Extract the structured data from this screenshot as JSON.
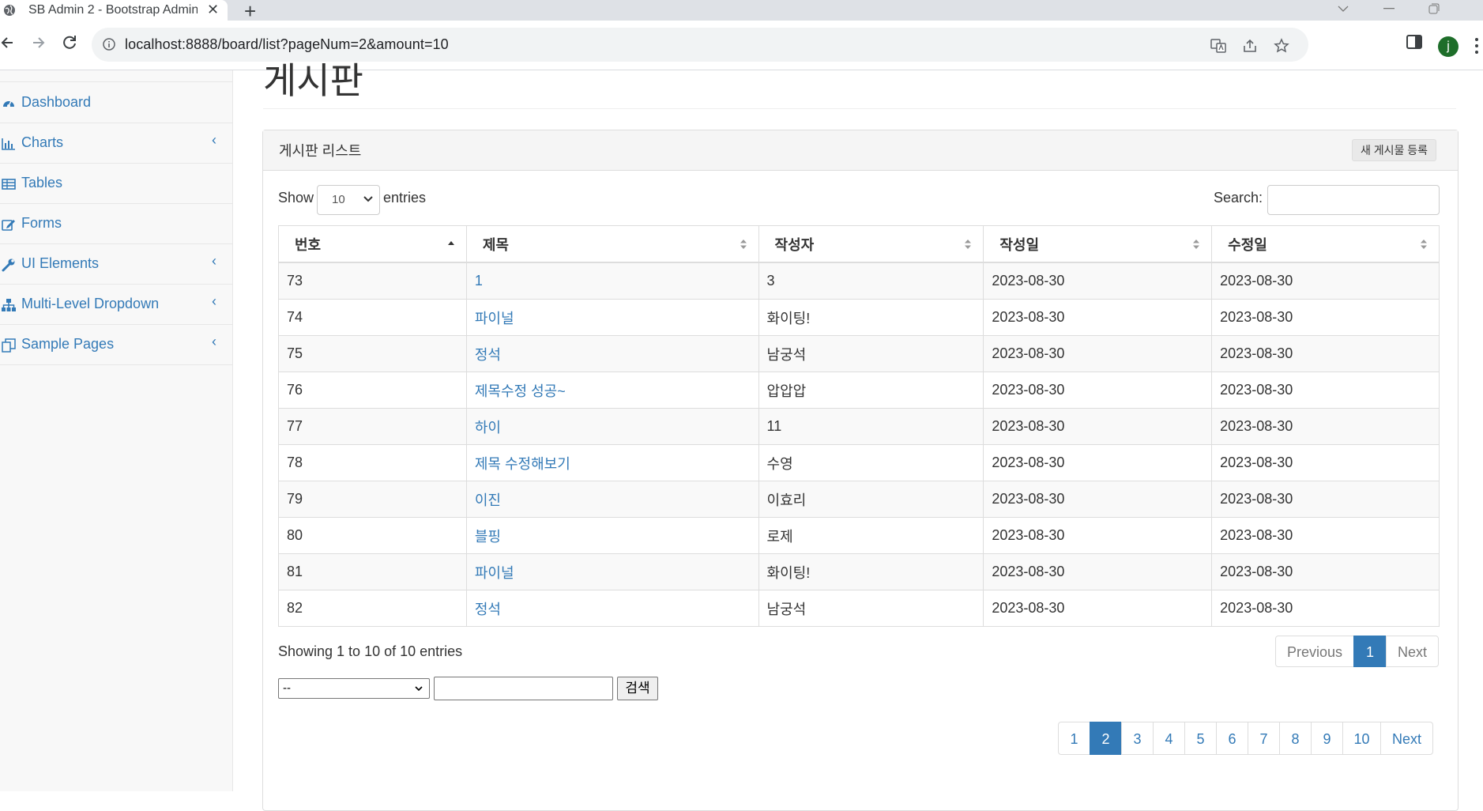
{
  "browser": {
    "tab_title": "SB Admin 2 - Bootstrap Admin",
    "tab_close": "✕",
    "new_tab": "+",
    "url": "localhost:8888/board/list?pageNum=2&amount=10",
    "profile_initial": "j"
  },
  "sidebar": {
    "items": [
      {
        "label": "Dashboard",
        "icon": "dashboard-icon",
        "caret": ""
      },
      {
        "label": "Charts",
        "icon": "bar-chart-icon",
        "caret": "‹"
      },
      {
        "label": "Tables",
        "icon": "table-icon",
        "caret": ""
      },
      {
        "label": "Forms",
        "icon": "edit-icon",
        "caret": ""
      },
      {
        "label": "UI Elements",
        "icon": "wrench-icon",
        "caret": "‹"
      },
      {
        "label": "Multi-Level Dropdown",
        "icon": "sitemap-icon",
        "caret": "‹"
      },
      {
        "label": "Sample Pages",
        "icon": "files-icon",
        "caret": "‹"
      }
    ]
  },
  "page": {
    "title": "게시판"
  },
  "panel": {
    "heading": "게시판 리스트",
    "register_button": "새 게시물 등록",
    "show_label": "Show",
    "page_length": "10",
    "entries_label": "entries",
    "search_label": "Search:",
    "columns": [
      "번호",
      "제목",
      "작성자",
      "작성일",
      "수정일"
    ],
    "rows": [
      {
        "no": "73",
        "title": "1",
        "writer": "3",
        "regdate": "2023-08-30",
        "updatedate": "2023-08-30"
      },
      {
        "no": "74",
        "title": "파이널",
        "writer": "화이팅!",
        "regdate": "2023-08-30",
        "updatedate": "2023-08-30"
      },
      {
        "no": "75",
        "title": "정석",
        "writer": "남궁석",
        "regdate": "2023-08-30",
        "updatedate": "2023-08-30"
      },
      {
        "no": "76",
        "title": "제목수정 성공~",
        "writer": "압압압",
        "regdate": "2023-08-30",
        "updatedate": "2023-08-30"
      },
      {
        "no": "77",
        "title": "하이",
        "writer": "11",
        "regdate": "2023-08-30",
        "updatedate": "2023-08-30"
      },
      {
        "no": "78",
        "title": "제목 수정해보기",
        "writer": "수영",
        "regdate": "2023-08-30",
        "updatedate": "2023-08-30"
      },
      {
        "no": "79",
        "title": "이진",
        "writer": "이효리",
        "regdate": "2023-08-30",
        "updatedate": "2023-08-30"
      },
      {
        "no": "80",
        "title": "블핑",
        "writer": "로제",
        "regdate": "2023-08-30",
        "updatedate": "2023-08-30"
      },
      {
        "no": "81",
        "title": "파이널",
        "writer": "화이팅!",
        "regdate": "2023-08-30",
        "updatedate": "2023-08-30"
      },
      {
        "no": "82",
        "title": "정석",
        "writer": "남궁석",
        "regdate": "2023-08-30",
        "updatedate": "2023-08-30"
      }
    ],
    "info": "Showing 1 to 10 of 10 entries",
    "dt_pager": {
      "previous": "Previous",
      "current": "1",
      "next": "Next"
    },
    "search_form": {
      "type_value": "--",
      "keyword": "",
      "button": "검색"
    },
    "board_pager": {
      "pages": [
        "1",
        "2",
        "3",
        "4",
        "5",
        "6",
        "7",
        "8",
        "9",
        "10"
      ],
      "active": "2",
      "next": "Next"
    }
  },
  "colors": {
    "link": "#337ab7",
    "active": "#337ab7",
    "sidebar_bg": "#f8f8f8"
  }
}
